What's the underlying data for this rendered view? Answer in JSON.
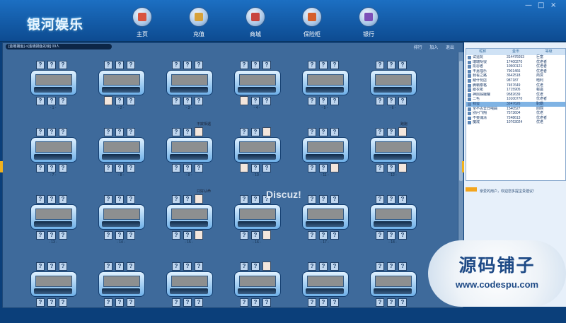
{
  "app": {
    "logo_text": "银河娱乐",
    "window_controls": [
      "—",
      "□",
      "×"
    ]
  },
  "nav": [
    {
      "label": "主页",
      "icon": "home-icon",
      "color": "#d9533f"
    },
    {
      "label": "充值",
      "icon": "wallet-icon",
      "color": "#d7a13a"
    },
    {
      "label": "商城",
      "icon": "shop-icon",
      "color": "#c8443e"
    },
    {
      "label": "保险柜",
      "icon": "safe-icon",
      "color": "#d55f2b"
    },
    {
      "label": "银行",
      "icon": "bank-icon",
      "color": "#7d4fb8"
    }
  ],
  "panel": {
    "breadcrumb": "[金蟾捕鱼]->[金蟾捕鱼初级] 09人",
    "tools": [
      "排行",
      "加入",
      "退出"
    ]
  },
  "tables": [
    {
      "num": "- 1 -",
      "players": []
    },
    {
      "num": "- 2 -",
      "players": [
        {
          "seat": "b1",
          "name": ""
        }
      ]
    },
    {
      "num": "- 3 -",
      "players": []
    },
    {
      "num": "- 4 -",
      "players": [
        {
          "seat": "b1",
          "name": ""
        }
      ]
    },
    {
      "num": "- 5 -",
      "players": []
    },
    {
      "num": "- 6 -",
      "players": []
    },
    {
      "num": "- 7 -",
      "players": []
    },
    {
      "num": "- 8 -",
      "players": []
    },
    {
      "num": "- 9 -",
      "players": [
        {
          "seat": "t3",
          "name": "不欺相遇"
        }
      ]
    },
    {
      "num": "- 10 -",
      "players": [
        {
          "seat": "t3",
          "name": ""
        },
        {
          "seat": "b1",
          "name": ""
        }
      ]
    },
    {
      "num": "- 11 -",
      "players": [
        {
          "seat": "b3",
          "name": ""
        }
      ]
    },
    {
      "num": "- 12 -",
      "players": [
        {
          "seat": "t3",
          "name": "跑跑"
        },
        {
          "seat": "b3",
          "name": ""
        }
      ]
    },
    {
      "num": "- 13 -",
      "players": []
    },
    {
      "num": "- 14 -",
      "players": []
    },
    {
      "num": "- 15 -",
      "players": [
        {
          "seat": "t3",
          "name": "只好认命"
        },
        {
          "seat": "b3",
          "name": ""
        }
      ]
    },
    {
      "num": "- 16 -",
      "players": [
        {
          "seat": "b3",
          "name": ""
        }
      ]
    },
    {
      "num": "- 17 -",
      "players": []
    },
    {
      "num": "- 18 -",
      "players": []
    },
    {
      "num": "",
      "players": []
    },
    {
      "num": "",
      "players": []
    },
    {
      "num": "",
      "players": []
    },
    {
      "num": "",
      "players": [
        {
          "seat": "t3",
          "name": ""
        }
      ]
    },
    {
      "num": "",
      "players": []
    },
    {
      "num": "",
      "players": []
    }
  ],
  "seat_mark": "?",
  "watermark": "Discuz!",
  "userlist": {
    "headers": [
      "昵称",
      "金币",
      "等级"
    ],
    "rows": [
      {
        "name": "试运玩",
        "gold": "314476053",
        "level": "巨富",
        "selected": false
      },
      {
        "name": "瑞瑞呀很",
        "gold": "17400270",
        "level": "优老者",
        "selected": false
      },
      {
        "name": "凯恩者",
        "gold": "10500121",
        "level": "优老者",
        "selected": false
      },
      {
        "name": "丰嘉理乐",
        "gold": "7901466",
        "level": "优老者",
        "selected": false
      },
      {
        "name": "我看之路",
        "gold": "3642518",
        "level": "商贾",
        "selected": false
      },
      {
        "name": "赌什玩店",
        "gold": "987187",
        "level": "暗利",
        "selected": false
      },
      {
        "name": "腾霸泰格",
        "gold": "7457649",
        "level": "优老",
        "selected": false
      },
      {
        "name": "跟衣拓",
        "gold": "1715905",
        "level": "秘盗",
        "selected": false
      },
      {
        "name": "神陨姊娥罐",
        "gold": "9582639",
        "level": "优老",
        "selected": false
      },
      {
        "name": "二毛",
        "gold": "10100770",
        "level": "优老者",
        "selected": false
      },
      {
        "name": "我蛋",
        "gold": "3247626",
        "level": "职霸",
        "selected": true
      },
      {
        "name": "全不古去日喂曲",
        "gold": "1540527",
        "level": "四网",
        "selected": false
      },
      {
        "name": "别问飞翔",
        "gold": "7573604",
        "level": "优老",
        "selected": false
      },
      {
        "name": "不要浦清",
        "gold": "7248613",
        "level": "优老者",
        "selected": false
      },
      {
        "name": "魔戒",
        "gold": "10763024",
        "level": "优老",
        "selected": false
      }
    ]
  },
  "chat": {
    "label": "系统",
    "message": "亲爱的用户，欢迎您多提宝贵建议！"
  },
  "badge": {
    "line1": "源码铺子",
    "line2": "www.codespu.com"
  }
}
